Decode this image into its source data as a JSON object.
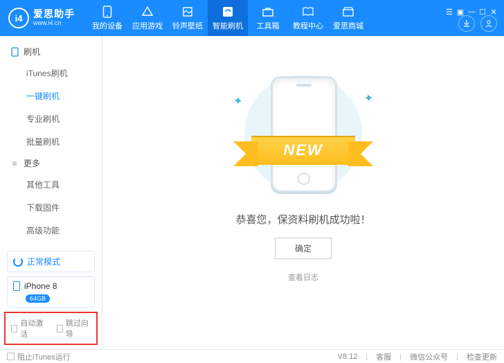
{
  "brand": {
    "logo_text": "i4",
    "name_cn": "爱思助手",
    "url": "www.i4.cn"
  },
  "nav": [
    {
      "label": "我的设备"
    },
    {
      "label": "应用游戏"
    },
    {
      "label": "铃声壁纸"
    },
    {
      "label": "智能刷机"
    },
    {
      "label": "工具箱"
    },
    {
      "label": "教程中心"
    },
    {
      "label": "爱思商城"
    }
  ],
  "sidebar": {
    "group1_title": "刷机",
    "items1": [
      "iTunes刷机",
      "一键刷机",
      "专业刷机",
      "批量刷机"
    ],
    "group2_title": "更多",
    "items2": [
      "其他工具",
      "下载固件",
      "高级功能"
    ],
    "mode_label": "正常模式",
    "device_name": "iPhone 8",
    "device_storage": "64GB",
    "cb_auto_activate": "自动激活",
    "cb_skip_wizard": "跳过向导"
  },
  "main": {
    "ribbon_text": "NEW",
    "message": "恭喜您，保资料刷机成功啦！",
    "ok_label": "确定",
    "log_link": "查看日志"
  },
  "footer": {
    "block_itunes": "阻止iTunes运行",
    "version": "V8.12",
    "support": "客服",
    "wechat": "微信公众号",
    "check_update": "检查更新"
  }
}
